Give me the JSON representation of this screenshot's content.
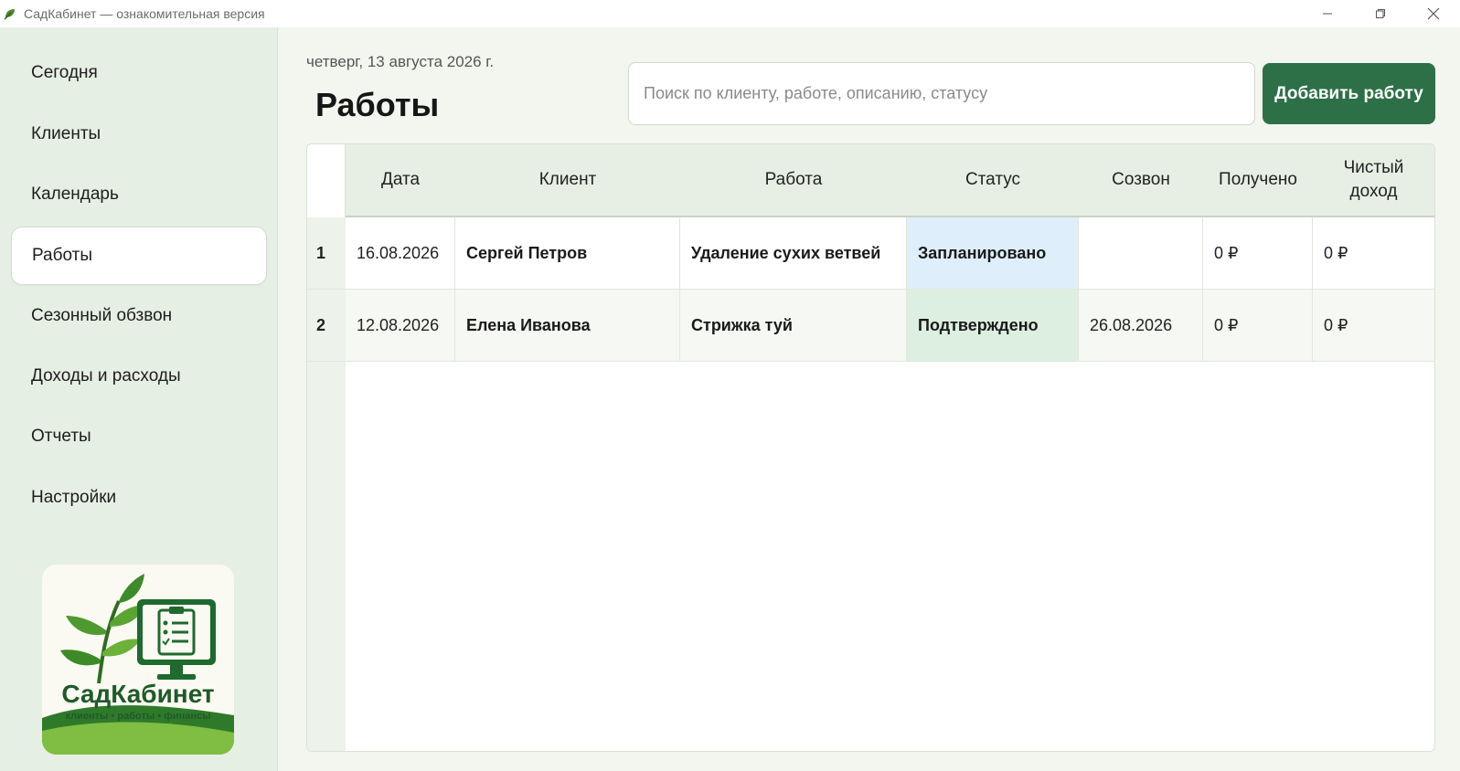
{
  "window": {
    "title": "СадКабинет — ознакомительная версия",
    "app_icon": "leaf-icon",
    "controls": [
      "minimize-icon",
      "restore-icon",
      "close-icon"
    ]
  },
  "sidebar": {
    "items": [
      {
        "label": "Сегодня",
        "active": false
      },
      {
        "label": "Клиенты",
        "active": false
      },
      {
        "label": "Календарь",
        "active": false
      },
      {
        "label": "Работы",
        "active": true
      },
      {
        "label": "Сезонный обзвон",
        "active": false
      },
      {
        "label": "Доходы и расходы",
        "active": false
      },
      {
        "label": "Отчеты",
        "active": false
      },
      {
        "label": "Настройки",
        "active": false
      }
    ],
    "logo": {
      "name": "СадКабинет",
      "tagline": "клиенты • работы • финансы"
    }
  },
  "header": {
    "date": "четверг, 13 августа 2026 г.",
    "title": "Работы",
    "search_placeholder": "Поиск по клиенту, работе, описанию, статусу",
    "search_value": "",
    "add_button": "Добавить работу"
  },
  "table": {
    "columns": [
      "Дата",
      "Клиент",
      "Работа",
      "Статус",
      "Созвон",
      "Получено",
      "Чистый доход"
    ],
    "rows": [
      {
        "index": "1",
        "date": "16.08.2026",
        "client": "Сергей Петров",
        "work": "Удаление сухих ветвей",
        "status": "Запланировано",
        "call": "",
        "received": "0 ₽",
        "net": "0 ₽"
      },
      {
        "index": "2",
        "date": "12.08.2026",
        "client": "Елена Иванова",
        "work": "Стрижка туй",
        "status": "Подтверждено",
        "call": "26.08.2026",
        "received": "0 ₽",
        "net": "0 ₽"
      }
    ]
  },
  "colors": {
    "accent": "#2d7048",
    "sidebar_bg": "#e6efe3",
    "status_planned": "#deeffb",
    "status_confirmed": "#ddefe0"
  }
}
